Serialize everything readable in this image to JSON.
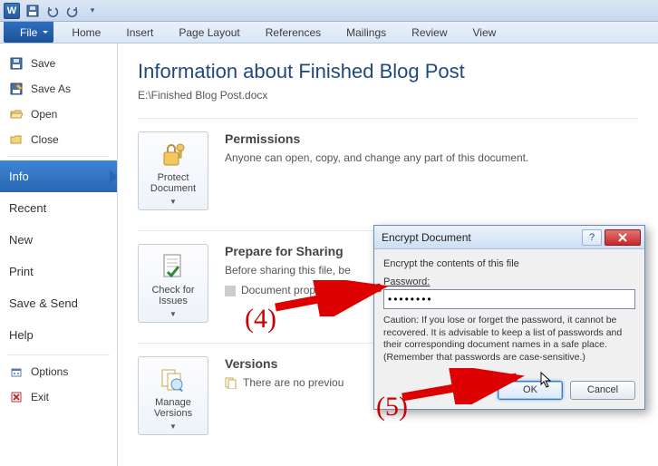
{
  "titlebar": {
    "app_letter": "W"
  },
  "ribbon": {
    "file": "File",
    "tabs": [
      "Home",
      "Insert",
      "Page Layout",
      "References",
      "Mailings",
      "Review",
      "View"
    ]
  },
  "sidebar": {
    "top": [
      {
        "label": "Save"
      },
      {
        "label": "Save As"
      },
      {
        "label": "Open"
      },
      {
        "label": "Close"
      }
    ],
    "mid": [
      {
        "label": "Info",
        "selected": true
      },
      {
        "label": "Recent"
      },
      {
        "label": "New"
      },
      {
        "label": "Print"
      },
      {
        "label": "Save & Send"
      },
      {
        "label": "Help"
      }
    ],
    "bottom": [
      {
        "label": "Options"
      },
      {
        "label": "Exit"
      }
    ]
  },
  "main": {
    "title": "Information about Finished Blog Post",
    "path": "E:\\Finished Blog Post.docx",
    "permissions": {
      "button": "Protect Document",
      "heading": "Permissions",
      "desc": "Anyone can open, copy, and change any part of this document."
    },
    "share": {
      "button": "Check for Issues",
      "heading": "Prepare for Sharing",
      "desc": "Before sharing this file, be",
      "bullet": "Document proper"
    },
    "versions": {
      "button": "Manage Versions",
      "heading": "Versions",
      "desc": "There are no previou"
    }
  },
  "dialog": {
    "title": "Encrypt Document",
    "instruction": "Encrypt the contents of this file",
    "password_label": "Password:",
    "password_value": "••••••••",
    "caution": "Caution: If you lose or forget the password, it cannot be recovered. It is advisable to keep a list of passwords and their corresponding document names in a safe place. (Remember that passwords are case-sensitive.)",
    "ok": "OK",
    "cancel": "Cancel"
  },
  "annotations": {
    "step4": "(4)",
    "step5": "(5)"
  }
}
